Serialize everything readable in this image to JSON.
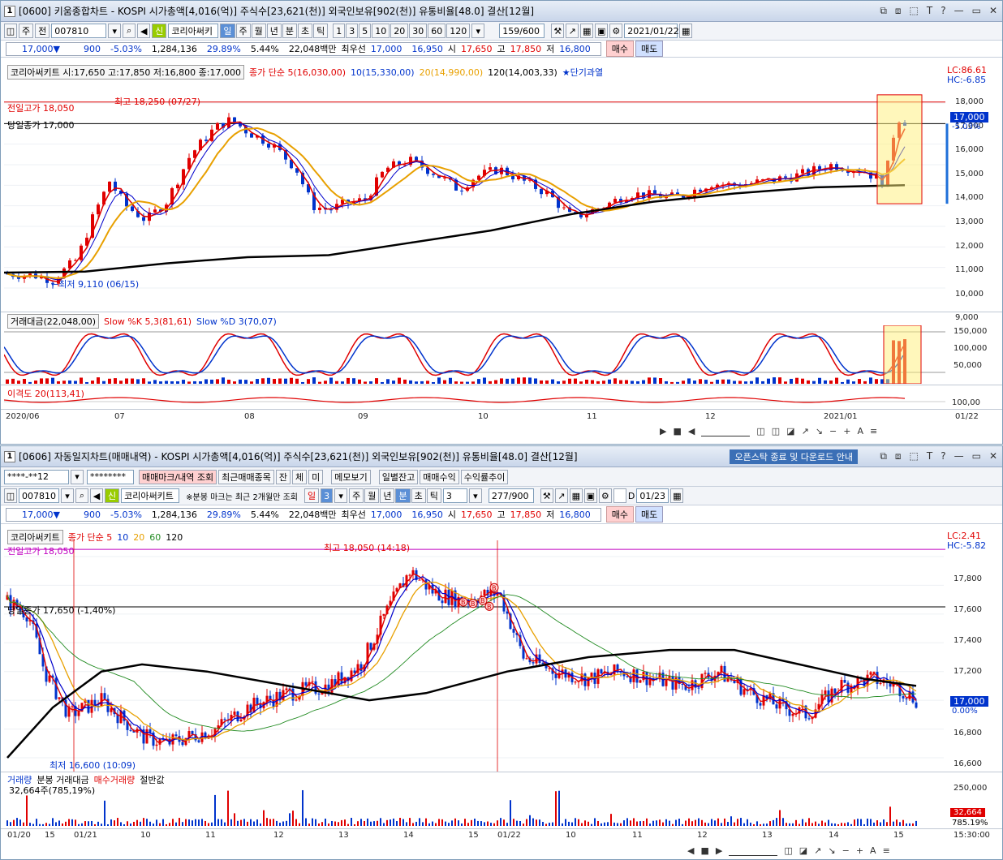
{
  "top": {
    "title": "[0600] 키움종합차트 - KOSPI 시가총액[4,016(억)] 주식수[23,621(천)] 외국인보유[902(천)] 유통비율[48.0] 결산[12월]",
    "win_num": "1",
    "toolbar": {
      "mode1": "주",
      "mode2": "전",
      "code": "007810",
      "flag": "신",
      "name": "코리아써키",
      "periods": [
        "일",
        "주",
        "월",
        "년",
        "분",
        "초",
        "틱"
      ],
      "selected_period": "일",
      "minutes": [
        "1",
        "3",
        "5",
        "10",
        "20",
        "30",
        "60",
        "120"
      ],
      "count": "159/600",
      "date": "2021/01/22"
    },
    "quote": {
      "price": "17,000▼",
      "change": "900",
      "pct": "-5.03%",
      "volume": "1,284,136",
      "turnover": "29.89%",
      "ratio": "5.44%",
      "amount": "22,048백만",
      "pref_label": "최우선",
      "ask": "17,000",
      "bid": "16,950",
      "open_label": "시",
      "open": "17,650",
      "high_label": "고",
      "high": "17,850",
      "low_label": "저",
      "low": "16,800",
      "buy": "매수",
      "sell": "매도"
    },
    "legend": {
      "name": "코리아써키트 시:17,650 고:17,850 저:16,800 종:17,000",
      "ma": "종가 단순 5(16,030,00)",
      "ma10": "10(15,330,00)",
      "ma20": "20(14,990,00)",
      "ma120": "120(14,003,33)",
      "star": "★단기과열"
    },
    "labels": {
      "prev_high": "전일고가 18,050",
      "prev_close": "당일종가 17,000",
      "max": "최고 18,250 (07/27)",
      "min": "←최저 9,110 (06/15)",
      "lc": "LC:86.61",
      "hc": "HC:-6.85",
      "cur_price": "17,000",
      "cur_pct": "-5.03%"
    },
    "yaxis": [
      "18,000",
      "17,000",
      "16,000",
      "15,000",
      "14,000",
      "13,000",
      "12,000",
      "11,000",
      "10,000",
      "9,000"
    ],
    "stoch_legend": {
      "vol": "거래대금(22,048,00)",
      "k": "Slow %K 5,3(81,61)",
      "d": "Slow %D 3(70,07)"
    },
    "stoch_axis": [
      "150,000",
      "100,000",
      "50,000"
    ],
    "disparity": "이격도 20(113,41)",
    "disp_axis": "100,00",
    "xaxis": [
      "2020/06",
      "07",
      "08",
      "09",
      "10",
      "11",
      "12",
      "2021/01"
    ],
    "xend": "01/22"
  },
  "bottom": {
    "title": "[0606] 자동일지차트(매매내역) - KOSPI 시가총액[4,016(억)] 주식수[23,621(천)] 외국인보유[902(천)] 유통비율[48.0] 결산[12월]",
    "win_num": "1",
    "notice_btn": "오픈스탁 종료 및 다운로드 안내",
    "account": "****-**12",
    "password": "********",
    "btns": [
      "매매마크/내역 조회",
      "최근매매종목",
      "잔",
      "체",
      "미",
      "메모보기",
      "일별잔고",
      "매매수익",
      "수익률추이"
    ],
    "toolbar": {
      "code": "007810",
      "flag": "신",
      "name": "코리아써키트",
      "note": "※분봉 마크는 최근 2개월만 조회",
      "period": "일",
      "period_n": "3",
      "periods": [
        "주",
        "월",
        "년",
        "분",
        "초",
        "틱"
      ],
      "selected_period": "분",
      "tick_n": "3",
      "count": "277/900",
      "d_label": "D",
      "date": "01/23"
    },
    "quote": {
      "price": "17,000▼",
      "change": "900",
      "pct": "-5.03%",
      "volume": "1,284,136",
      "turnover": "29.89%",
      "ratio": "5.44%",
      "amount": "22,048백만",
      "pref_label": "최우선",
      "ask": "17,000",
      "bid": "16,950",
      "open_label": "시",
      "open": "17,650",
      "high_label": "고",
      "high": "17,850",
      "low_label": "저",
      "low": "16,800",
      "buy": "매수",
      "sell": "매도"
    },
    "legend": {
      "name": "코리아써키트",
      "ma": "종가 단순 5",
      "ma10": "10",
      "ma20": "20",
      "ma60": "60",
      "ma120": "120"
    },
    "labels": {
      "prev_high": "전일고가 18,050",
      "prev_close": "당일종가 17,650 (-1,40%)",
      "max": "최고 18,050 (14:18)",
      "min": "최저 16,600 (10:09)",
      "lc": "LC:2.41",
      "hc": "HC:-5.82",
      "cur_price": "17,000",
      "cur_pct": "0.00%",
      "buy_mark": "B"
    },
    "yaxis": [
      "17,800",
      "17,600",
      "17,400",
      "17,200",
      "17,000",
      "16,800",
      "16,600"
    ],
    "vol_legend": {
      "vol": "거래량",
      "amount": "분봉 거래대금",
      "buy": "매수거래량",
      "half": "절반값"
    },
    "vol_sub": "32,664주(785,19%)",
    "vol_axis": "250,000",
    "vol_cur": "32,664",
    "vol_cur_pct": "785.19%",
    "xaxis": [
      "01/20",
      "15",
      "01/21",
      "10",
      "11",
      "12",
      "13",
      "14",
      "15",
      "01/22",
      "10",
      "11",
      "12",
      "13",
      "14",
      "15"
    ],
    "xend": "15:30:00"
  },
  "colors": {
    "up": "#e00000",
    "down": "#0033cc",
    "ma5": "#e00000",
    "ma10": "#0000cc",
    "ma20": "#e8a000",
    "ma60": "#228b22",
    "ma120": "#000000"
  }
}
